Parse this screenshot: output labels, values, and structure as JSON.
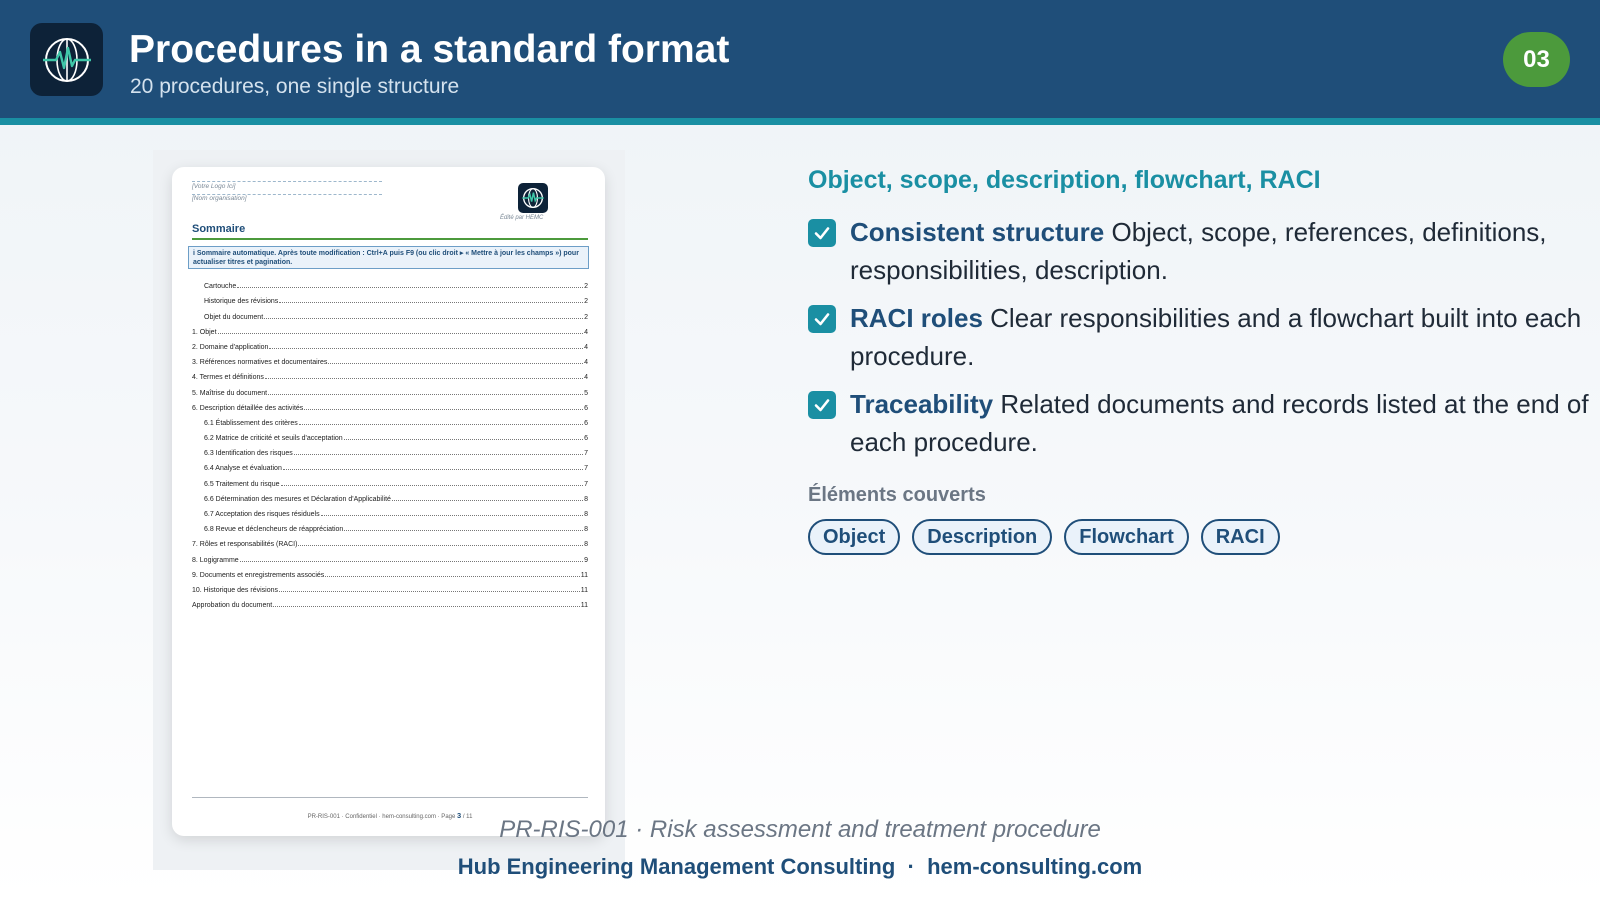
{
  "header": {
    "title": "Procedures in a standard format",
    "subtitle": "20 procedures, one single structure",
    "badge": "03",
    "logo_icon": "globe-heartbeat-icon"
  },
  "document_preview": {
    "logo_placeholder": "[Votre Logo Ici]",
    "org_placeholder": "[Nom organisation]",
    "edited_by": "Édité par HEMC",
    "sommaire_title": "Sommaire",
    "info_text": "i  Sommaire automatique. Après toute modification : Ctrl+A puis F9 (ou clic droit ▸ « Mettre à jour les champs ») pour actualiser titres et pagination.",
    "toc": [
      {
        "label": "Cartouche",
        "page": "2",
        "indent": true
      },
      {
        "label": "Historique des révisions",
        "page": "2",
        "indent": true
      },
      {
        "label": "Objet du document",
        "page": "2",
        "indent": true
      },
      {
        "label": "1. Objet",
        "page": "4",
        "indent": false
      },
      {
        "label": "2. Domaine d'application",
        "page": "4",
        "indent": false
      },
      {
        "label": "3. Références normatives et documentaires",
        "page": "4",
        "indent": false
      },
      {
        "label": "4. Termes et définitions",
        "page": "4",
        "indent": false
      },
      {
        "label": "5. Maîtrise du document",
        "page": "5",
        "indent": false
      },
      {
        "label": "6. Description détaillée des activités",
        "page": "6",
        "indent": false
      },
      {
        "label": "6.1 Établissement des critères",
        "page": "6",
        "indent": true
      },
      {
        "label": "6.2 Matrice de criticité et seuils d'acceptation",
        "page": "6",
        "indent": true
      },
      {
        "label": "6.3 Identification des risques",
        "page": "7",
        "indent": true
      },
      {
        "label": "6.4 Analyse et évaluation",
        "page": "7",
        "indent": true
      },
      {
        "label": "6.5 Traitement du risque",
        "page": "7",
        "indent": true
      },
      {
        "label": "6.6 Détermination des mesures et Déclaration d'Applicabilité",
        "page": "8",
        "indent": true
      },
      {
        "label": "6.7 Acceptation des risques résiduels",
        "page": "8",
        "indent": true
      },
      {
        "label": "6.8 Revue et déclencheurs de réappréciation",
        "page": "8",
        "indent": true
      },
      {
        "label": "7. Rôles et responsabilités (RACI)",
        "page": "8",
        "indent": false
      },
      {
        "label": "8. Logigramme",
        "page": "9",
        "indent": false
      },
      {
        "label": "9. Documents et enregistrements associés",
        "page": "11",
        "indent": false
      },
      {
        "label": "10. Historique des révisions",
        "page": "11",
        "indent": false
      },
      {
        "label": "Approbation du document",
        "page": "11",
        "indent": false
      }
    ],
    "footer_text": "PR-RIS-001 · Confidentiel · hem-consulting.com · Page",
    "footer_page": "3",
    "footer_total": "/ 11"
  },
  "panel": {
    "section_title": "Object, scope, description, flowchart, RACI",
    "features": [
      {
        "title": "Consistent structure",
        "text": "Object, scope, references, definitions, responsibilities, description."
      },
      {
        "title": "RACI roles",
        "text": "Clear responsibilities and a flowchart built into each procedure."
      },
      {
        "title": "Traceability",
        "text": "Related documents and records listed at the end of each procedure."
      }
    ],
    "covered_label": "Éléments couverts",
    "chips": [
      "Object",
      "Description",
      "Flowchart",
      "RACI"
    ]
  },
  "footer": {
    "reference": "PR-RIS-001 · Risk assessment and treatment procedure",
    "company": "Hub Engineering Management Consulting",
    "separator": "·",
    "website": "hem-consulting.com"
  },
  "colors": {
    "header_bg": "#1f4e79",
    "accent_teal": "#1a8fa3",
    "badge_green": "#4c9a3c"
  }
}
